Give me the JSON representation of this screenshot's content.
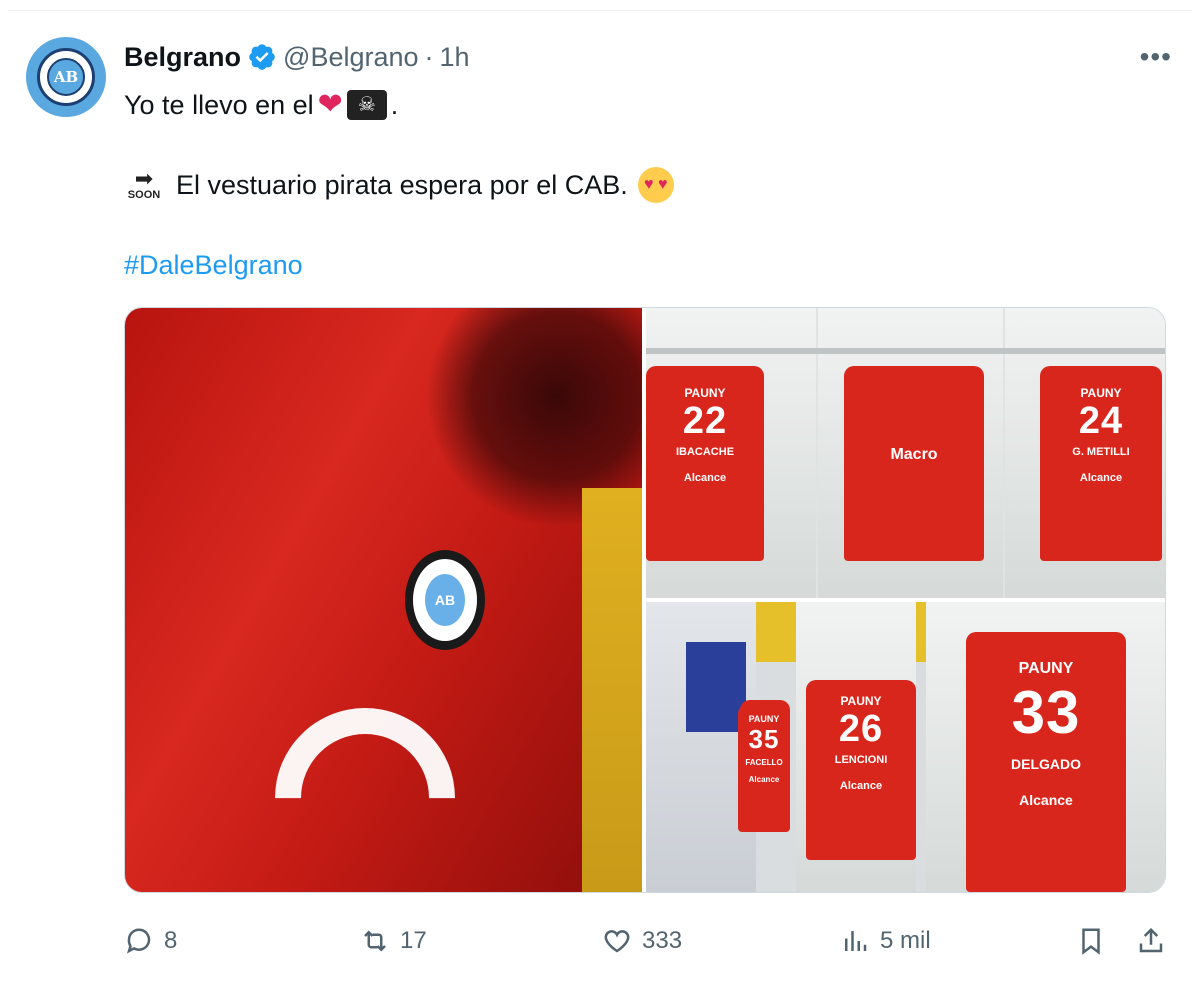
{
  "tweet": {
    "author": {
      "name": "Belgrano",
      "handle": "@Belgrano",
      "separator": "·",
      "time": "1h",
      "avatar_text": "AB"
    },
    "menu_label": "•••",
    "text": {
      "line1_prefix": "Yo te llevo en el",
      "line1_suffix": ".",
      "line2": "El vestuario pirata espera por el CAB.",
      "soon_label": "SOON",
      "hashtag": "#DaleBelgrano"
    },
    "emoji": {
      "heart": "❤",
      "skull": "☠",
      "soon_arrow": "➡",
      "heart_eyes": "♥ ♥"
    },
    "media": {
      "main": {
        "badge_text": "AB"
      },
      "top_right_jerseys": [
        {
          "brand": "PAUNY",
          "number": "22",
          "player": "IBACACHE",
          "sponsor": "Alcance"
        },
        {
          "brand": "Macro",
          "number": "",
          "player": "",
          "sponsor": ""
        },
        {
          "brand": "PAUNY",
          "number": "24",
          "player": "G. METILLI",
          "sponsor": "Alcance"
        }
      ],
      "bottom_right_jerseys": [
        {
          "brand": "PAUNY",
          "number": "35",
          "player": "FACELLO",
          "sponsor": "Alcance"
        },
        {
          "brand": "PAUNY",
          "number": "26",
          "player": "LENCIONI",
          "sponsor": "Alcance"
        },
        {
          "brand": "PAUNY",
          "number": "33",
          "player": "DELGADO",
          "sponsor": "Alcance"
        }
      ]
    },
    "actions": {
      "replies": "8",
      "reposts": "17",
      "likes": "333",
      "views": "5 mil"
    }
  }
}
